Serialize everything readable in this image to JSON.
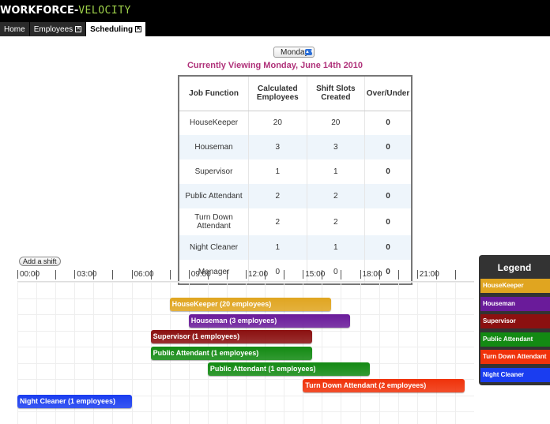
{
  "app": {
    "title_part1": "WORKFORCE-",
    "title_part2": "VELOCITY"
  },
  "tabs": [
    {
      "label": "Home",
      "closable": false
    },
    {
      "label": "Employees",
      "closable": true
    },
    {
      "label": "Scheduling",
      "closable": true,
      "active": true
    }
  ],
  "day_select": {
    "value": "Monday"
  },
  "viewing_text": "Currently Viewing Monday, June 14th 2010",
  "table": {
    "headers": [
      "Job Function",
      "Calculated Employees",
      "Shift Slots Created",
      "Over/Under"
    ],
    "rows": [
      [
        "HouseKeeper",
        "20",
        "20",
        "0"
      ],
      [
        "Houseman",
        "3",
        "3",
        "0"
      ],
      [
        "Supervisor",
        "1",
        "1",
        "0"
      ],
      [
        "Public Attendant",
        "2",
        "2",
        "0"
      ],
      [
        "Turn Down Attendant",
        "2",
        "2",
        "0"
      ],
      [
        "Night Cleaner",
        "1",
        "1",
        "0"
      ],
      [
        "Manager",
        "0",
        "0",
        "0"
      ]
    ]
  },
  "add_shift_label": "Add a shift",
  "timeline": {
    "hour_labels": [
      "00:00",
      "03:00",
      "06:00",
      "09:00",
      "12:00",
      "15:00",
      "18:00",
      "21:00"
    ],
    "shifts": [
      {
        "label": "HouseKeeper (20 employees)",
        "start": 8,
        "end": 16.5,
        "row": 0,
        "color": "#e0a520"
      },
      {
        "label": "Houseman (3 employees)",
        "start": 9,
        "end": 17.5,
        "row": 1,
        "color": "#6a1b9a"
      },
      {
        "label": "Supervisor (1 employees)",
        "start": 7,
        "end": 15.5,
        "row": 2,
        "color": "#8b1010"
      },
      {
        "label": "Public Attendant (1 employees)",
        "start": 7,
        "end": 15.5,
        "row": 3,
        "color": "#138a13"
      },
      {
        "label": "Public Attendant (1 employees)",
        "start": 10,
        "end": 18.5,
        "row": 4,
        "color": "#138a13"
      },
      {
        "label": "Turn Down Attendant (2 employees)",
        "start": 15,
        "end": 23.5,
        "row": 5,
        "color": "#f0320a"
      },
      {
        "label": "Night Cleaner (1 employees)",
        "start": 0,
        "end": 6,
        "row": 6,
        "color": "#1a3df0"
      }
    ]
  },
  "legend": {
    "title": "Legend",
    "items": [
      {
        "label": "HouseKeeper",
        "color": "#e0a520"
      },
      {
        "label": "Houseman",
        "color": "#6a1b9a"
      },
      {
        "label": "Supervisor",
        "color": "#8b1010"
      },
      {
        "label": "Public Attendant",
        "color": "#138a13"
      },
      {
        "label": "Turn Down Attendant",
        "color": "#f0320a"
      },
      {
        "label": "Night Cleaner",
        "color": "#1a3df0"
      }
    ]
  }
}
